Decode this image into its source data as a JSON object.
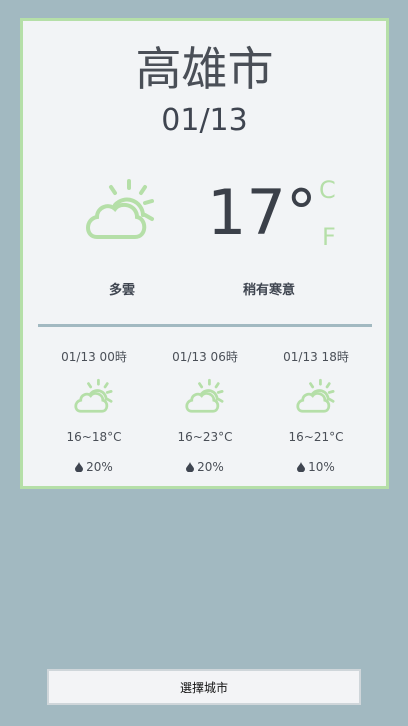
{
  "weather": {
    "city": "高雄市",
    "date": "01/13",
    "temperature": "17°",
    "unit_c": "C",
    "unit_f": "F",
    "description": "多雲",
    "comfort": "稍有寒意",
    "icon": "partly-cloudy-icon"
  },
  "forecast": [
    {
      "time": "01/13 00時",
      "temp": "16~18°C",
      "rain": "20%",
      "icon": "partly-cloudy-icon"
    },
    {
      "time": "01/13 06時",
      "temp": "16~23°C",
      "rain": "20%",
      "icon": "partly-cloudy-icon"
    },
    {
      "time": "01/13 18時",
      "temp": "16~21°C",
      "rain": "10%",
      "icon": "partly-cloudy-icon"
    }
  ],
  "button": {
    "label": "選擇城市"
  },
  "colors": {
    "background": "#a2b9c1",
    "card": "#f2f4f6",
    "accent": "#b5dfa8",
    "text": "#3f4550"
  }
}
